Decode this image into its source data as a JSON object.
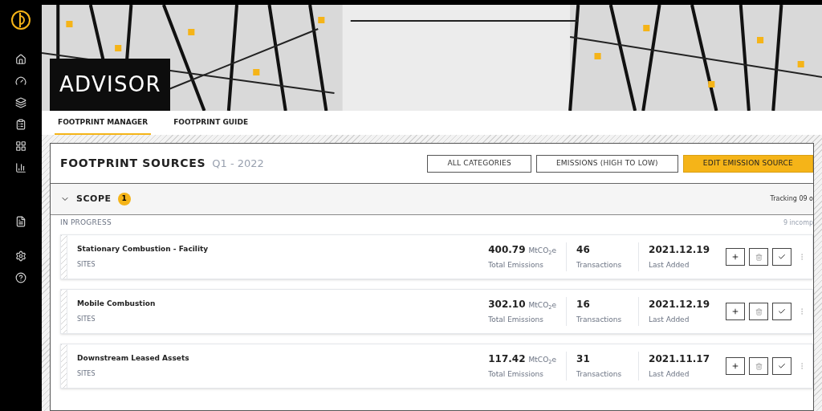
{
  "app": {
    "title": "ADVISOR"
  },
  "sidebar": {
    "items": [
      {
        "kind": "home"
      },
      {
        "kind": "gauge"
      },
      {
        "kind": "stack"
      },
      {
        "kind": "clipboard"
      },
      {
        "kind": "table"
      },
      {
        "kind": "chart"
      },
      {
        "kind": "report"
      },
      {
        "kind": "settings"
      },
      {
        "kind": "help"
      }
    ]
  },
  "tabs": [
    {
      "label": "FOOTPRINT MANAGER",
      "selected": true
    },
    {
      "label": "FOOTPRINT GUIDE",
      "selected": false
    }
  ],
  "header": {
    "title": "FOOTPRINT SOURCES",
    "period": "Q1 - 2022",
    "buttons": [
      {
        "label": "ALL CATEGORIES",
        "kind": "outline"
      },
      {
        "label": "EMISSIONS (HIGH TO LOW)",
        "kind": "outline"
      },
      {
        "label": "EDIT EMISSION SOURCE",
        "kind": "primary"
      }
    ]
  },
  "scope": {
    "label": "SCOPE",
    "badge": "1",
    "expanded": true,
    "tracking": "Tracking 09 o"
  },
  "section": {
    "label": "IN PROGRESS",
    "count": "9 incomp"
  },
  "sources": [
    {
      "name": "Stationary Combustion - Facility",
      "category": "SITES",
      "emissions": "400.79",
      "unit": "MtCO$_{2}$e",
      "emissions_label": "Total Emissions",
      "transactions": "46",
      "transactions_label": "Transactions",
      "last_added": "2021.12.19",
      "last_added_label": "Last Added"
    },
    {
      "name": "Mobile Combustion",
      "category": "SITES",
      "emissions": "302.10",
      "unit": "MtCO$_{2}$e",
      "emissions_label": "Total Emissions",
      "transactions": "16",
      "transactions_label": "Transactions",
      "last_added": "2021.12.19",
      "last_added_label": "Last Added"
    },
    {
      "name": "Downstream Leased Assets",
      "category": "SITES",
      "emissions": "117.42",
      "unit": "MtCO$_{2}$e",
      "emissions_label": "Total Emissions",
      "transactions": "31",
      "transactions_label": "Transactions",
      "last_added": "2021.11.17",
      "last_added_label": "Last Added"
    }
  ]
}
